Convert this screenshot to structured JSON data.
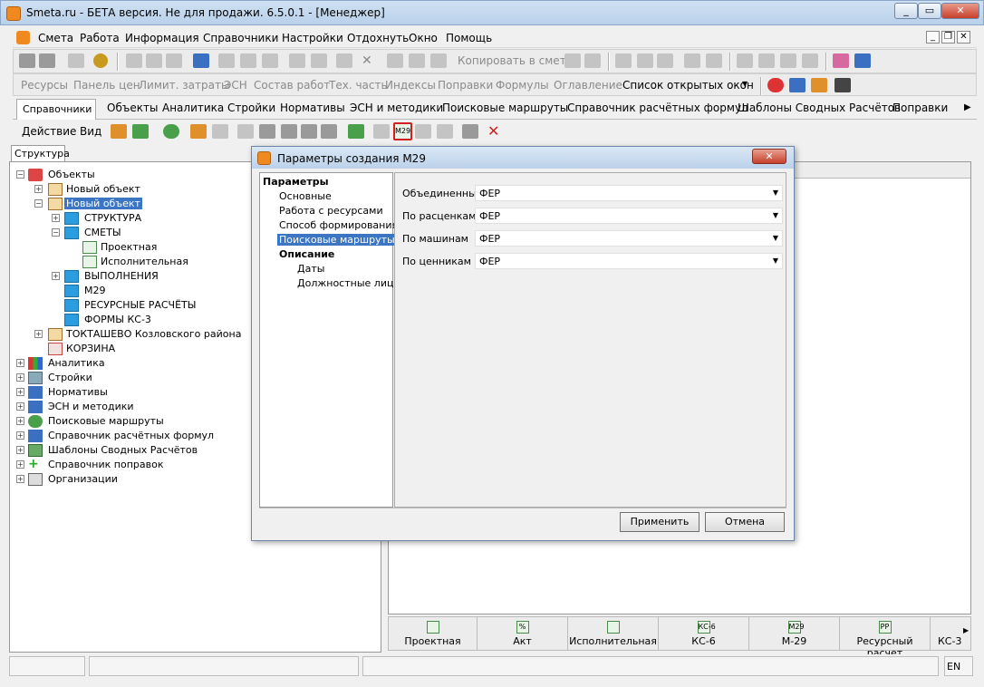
{
  "window": {
    "title": "Smeta.ru - БЕТА версия. Не для продажи.  6.5.0.1   - [Менеджер]"
  },
  "menu": {
    "items": [
      "Смета",
      "Работа",
      "Информация",
      "Справочники",
      "Настройки",
      "Отдохнуть",
      "Окно",
      "Помощь"
    ]
  },
  "toolbar1": {
    "copy_to_smeta": "Копировать в смету"
  },
  "toolbar2": {
    "items": [
      "Ресурсы",
      "Панель цен",
      "Лимит. затраты",
      "ЭСН",
      "Состав работ",
      "Тех. часть",
      "Индексы",
      "Поправки",
      "Формулы",
      "Оглавление"
    ],
    "open_windows": "Список открытых окон"
  },
  "tabs": [
    "Справочники",
    "Объекты",
    "Аналитика",
    "Стройки",
    "Нормативы",
    "ЭСН и методики",
    "Поисковые маршруты",
    "Справочник расчётных формул",
    "Шаблоны Сводных Расчётов",
    "Поправки"
  ],
  "toolbar3": {
    "action": "Действие",
    "view": "Вид"
  },
  "left_panel": {
    "tab": "Структура",
    "tree": {
      "root": "Объекты",
      "obj1": "Новый объект",
      "obj2": "Новый объект",
      "struktura": "СТРУКТУРА",
      "smety": "СМЕТЫ",
      "proektnaya": "Проектная",
      "ispolnitelnaya": "Исполнительная",
      "vypolneniya": "ВЫПОЛНЕНИЯ",
      "m29": "М29",
      "resursnye": "РЕСУРСНЫЕ РАСЧЁТЫ",
      "formy": "ФОРМЫ КС-3",
      "toktashevo": "ТОКТАШЕВО Козловского района",
      "korzina": "КОРЗИНА",
      "analitika": "Аналитика",
      "stroyki": "Стройки",
      "normativy": "Нормативы",
      "esn": "ЭСН и методики",
      "poisk": "Поисковые маршруты",
      "spravochnik_formul": "Справочник расчётных формул",
      "shablony": "Шаблоны Сводных Расчётов",
      "popravki": "Справочник поправок",
      "organizacii": "Организации"
    }
  },
  "bottom_tabs": [
    "Проектная",
    "Акт",
    "Исполнительная",
    "КС-6",
    "М-29",
    "Ресурсный расчет",
    "КС-3"
  ],
  "bottom_tab_icons": [
    "",
    "%",
    "",
    "КС-6",
    "М29",
    "РР",
    ""
  ],
  "status": {
    "lang": "EN"
  },
  "dialog": {
    "title": "Параметры создания М29",
    "tree": {
      "parametry": "Параметры",
      "osnovnye": "Основные",
      "rabota": "Работа с ресурсами",
      "sposob": "Способ формирования",
      "poisk": "Поисковые маршруты",
      "opisanie": "Описание",
      "daty": "Даты",
      "dolzhnostnye": "Должностные лица"
    },
    "fields": [
      {
        "label": "Объединенный",
        "value": "ФЕР"
      },
      {
        "label": "По расценкам",
        "value": "ФЕР"
      },
      {
        "label": "По машинам",
        "value": "ФЕР"
      },
      {
        "label": "По ценникам",
        "value": "ФЕР"
      }
    ],
    "apply": "Применить",
    "cancel": "Отмена"
  }
}
